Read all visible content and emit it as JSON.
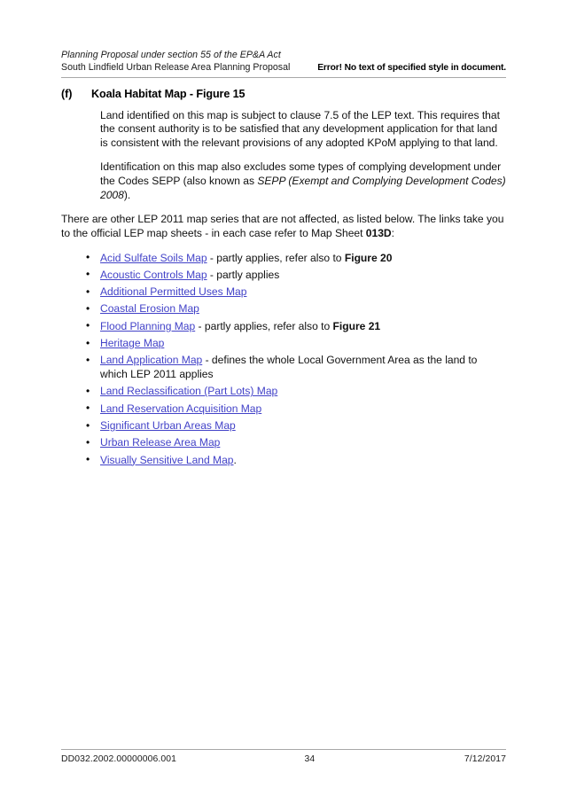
{
  "header": {
    "line1": "Planning Proposal under section 55 of the EP&A Act",
    "line2_left": "South Lindfield Urban Release Area Planning Proposal",
    "line2_right": "Error! No text of specified style in document."
  },
  "section": {
    "marker": "(f)",
    "title": "Koala Habitat Map",
    "title_suffix": " - ",
    "figure_ref": "Figure 15"
  },
  "paragraphs": {
    "p1": "Land identified on this map is subject to clause 7.5 of the LEP text.  This requires that the consent authority is to be satisfied that any development application for that land is consistent with the relevant provisions of any adopted KPoM applying to that land.",
    "p2_part1": "Identification on this map also excludes some types of complying development under the Codes SEPP (also known as ",
    "p2_italic": "SEPP (Exempt and Complying Development Codes) 2008",
    "p2_part2": ").",
    "lead_part1": "There are other LEP 2011 map series that are not affected, as listed below.  The links take you to the official LEP map sheets - in each case refer to Map Sheet ",
    "lead_bold": "013D",
    "lead_part2": ":"
  },
  "map_list": [
    {
      "link": "Acid Sulfate Soils Map",
      "trail_before": " - partly applies, refer also to ",
      "trail_bold": "Figure 20",
      "trail_after": ""
    },
    {
      "link": "Acoustic Controls Map",
      "trail_before": " - partly applies",
      "trail_bold": "",
      "trail_after": ""
    },
    {
      "link": "Additional Permitted Uses Map",
      "trail_before": "",
      "trail_bold": "",
      "trail_after": ""
    },
    {
      "link": "Coastal Erosion Map",
      "trail_before": "",
      "trail_bold": "",
      "trail_after": ""
    },
    {
      "link": "Flood Planning Map",
      "trail_before": " - partly applies, refer also to ",
      "trail_bold": "Figure 21",
      "trail_after": ""
    },
    {
      "link": "Heritage Map",
      "trail_before": "",
      "trail_bold": "",
      "trail_after": ""
    },
    {
      "link": "Land Application Map",
      "trail_before": " - defines the whole Local Government Area as the land to which LEP 2011 applies",
      "trail_bold": "",
      "trail_after": ""
    },
    {
      "link": "Land Reclassification (Part Lots) Map",
      "trail_before": "",
      "trail_bold": "",
      "trail_after": ""
    },
    {
      "link": "Land Reservation Acquisition Map",
      "trail_before": "",
      "trail_bold": "",
      "trail_after": ""
    },
    {
      "link": "Significant Urban Areas Map",
      "trail_before": "",
      "trail_bold": "",
      "trail_after": ""
    },
    {
      "link": "Urban Release Area Map",
      "trail_before": "",
      "trail_bold": "",
      "trail_after": ""
    },
    {
      "link": "Visually Sensitive Land Map",
      "trail_before": ".",
      "trail_bold": "",
      "trail_after": ""
    }
  ],
  "footer": {
    "doc_id": "DD032.2002.00000006.001",
    "page_number": "34",
    "date": "7/12/2017"
  },
  "colors": {
    "link": "#4242c8",
    "text": "#111111",
    "rule": "#a8a8a8",
    "page_background": "#ffffff"
  }
}
